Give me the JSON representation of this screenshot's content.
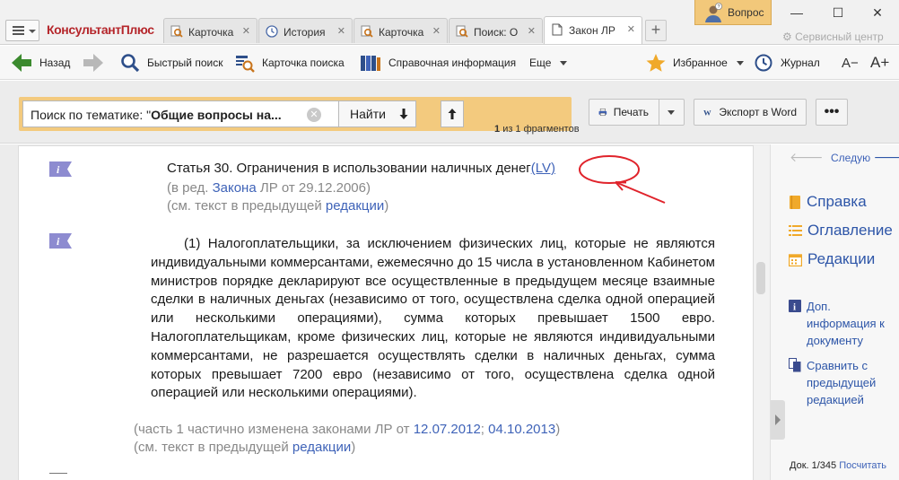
{
  "app": {
    "logo": "КонсультантПлюс"
  },
  "tabs": [
    {
      "label": "Карточка",
      "icon": "search-card-icon"
    },
    {
      "label": "История",
      "icon": "history-clock-icon"
    },
    {
      "label": "Карточка",
      "icon": "search-card-icon"
    },
    {
      "label": "Поиск: О",
      "icon": "search-card-icon"
    },
    {
      "label": "Закон ЛР",
      "icon": "document-icon",
      "active": true
    }
  ],
  "window": {
    "question": "Вопрос",
    "service_center": "Сервисный центр"
  },
  "toolbar": {
    "back": "Назад",
    "quick_search": "Быстрый поиск",
    "search_card": "Карточка поиска",
    "reference": "Справочная информация",
    "more": "Еще",
    "favorites": "Избранное",
    "journal": "Журнал",
    "font_smaller": "A−",
    "font_larger": "A+"
  },
  "search": {
    "prefix": "Поиск по тематике: \"",
    "query": "Общие вопросы на...",
    "find": "Найти",
    "fragments_num": "1",
    "fragments_text": "из 1 фрагментов",
    "print": "Печать",
    "export_word": "Экспорт в Word"
  },
  "document": {
    "article_title": "Статья 30. Ограничения в использовании наличных денег",
    "lv_link": "(LV)",
    "title_note_1_pre": "(в ред. ",
    "title_note_1_link": "Закона",
    "title_note_1_post": " ЛР от 29.12.2006)",
    "title_note_2_pre": "(см. текст в предыдущей ",
    "title_note_2_link": "редакции",
    "title_note_2_post": ")",
    "para_1": "(1) Налогоплательщики, за исключением физических лиц, которые не являются индивидуальными коммерсантами, ежемесячно до 15 числа в установленном Кабинетом министров порядке декларируют все осуществленные в предыдущем месяце взаимные сделки в наличных деньгах (независимо от того, осуществлена сделка одной операцией или несколькими операциями), сумма которых превышает 1500 евро. Налогоплательщикам, кроме физических лиц, которые не являются индивидуальными коммерсантами, не разрешается осуществлять сделки в наличных деньгах, сумма которых превышает 7200 евро (независимо от того, осуществлена сделка одной операцией или несколькими операциями).",
    "para_note_1_pre": "(часть 1 частично изменена законами ЛР от ",
    "para_note_1_link_1": "12.07.2012",
    "para_note_1_sep": "; ",
    "para_note_1_link_2": "04.10.2013",
    "para_note_1_post": ")",
    "para_note_2_pre": "(см. текст в предыдущей ",
    "para_note_2_link": "редакции",
    "para_note_2_post": ")"
  },
  "right_panel": {
    "next": "Следую",
    "help": "Справка",
    "contents": "Оглавление",
    "editions": "Редакции",
    "extra_info": "Доп. информация к документу",
    "compare": "Сравнить с предыдущей редакцией",
    "status_pre": "Док. 1/345 ",
    "status_link": "Посчитать"
  },
  "colors": {
    "accent_orange": "#f3ca7e",
    "link_blue": "#3f63b8",
    "panel_blue": "#2e56a8",
    "annotation_red": "#e0232b",
    "nav_green": "#3b8a2e"
  }
}
